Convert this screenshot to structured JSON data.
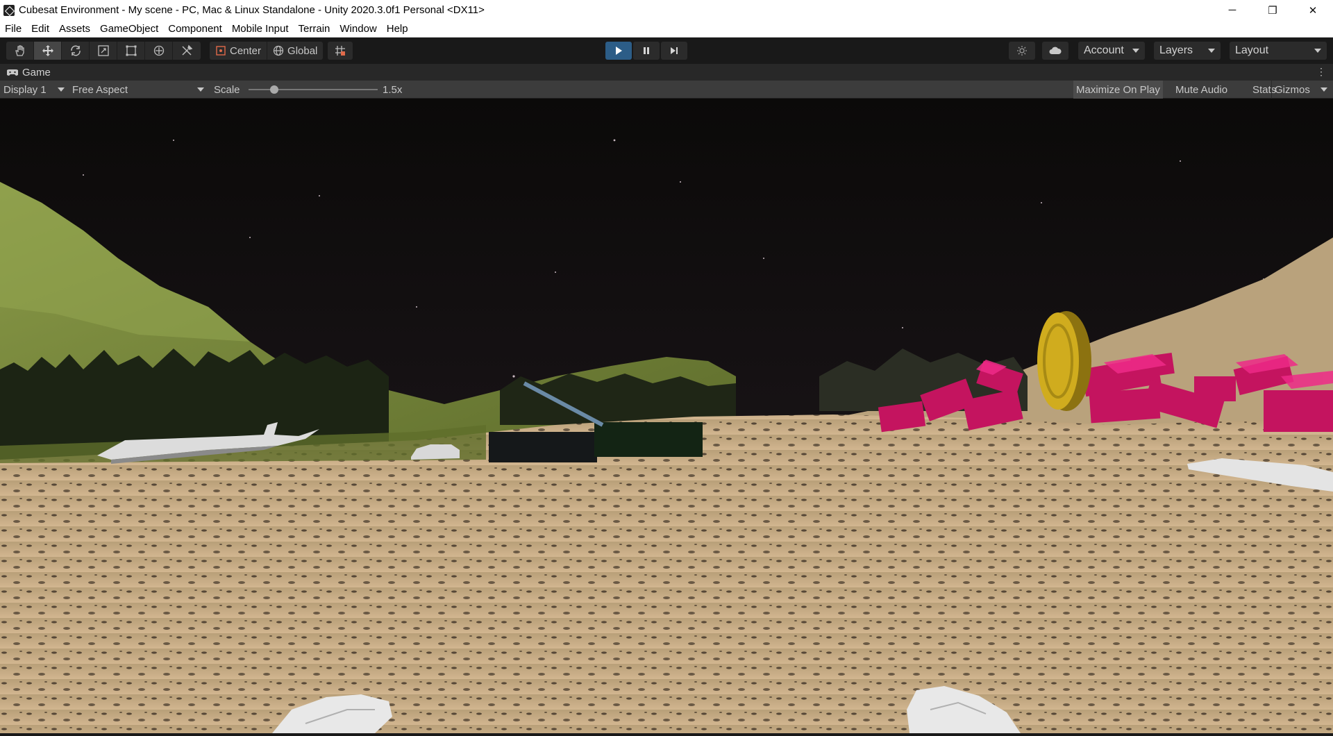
{
  "window": {
    "title": "Cubesat Environment - My scene - PC, Mac & Linux Standalone - Unity 2020.3.0f1 Personal <DX11>",
    "minimize_glyph": "─",
    "maximize_glyph": "❐",
    "close_glyph": "✕"
  },
  "menu": [
    "File",
    "Edit",
    "Assets",
    "GameObject",
    "Component",
    "Mobile Input",
    "Terrain",
    "Window",
    "Help"
  ],
  "toolbar": {
    "tools": [
      {
        "name": "hand-tool",
        "icon": "hand-icon",
        "active": false
      },
      {
        "name": "move-tool",
        "icon": "move-icon",
        "active": true
      },
      {
        "name": "rotate-tool",
        "icon": "rotate-icon",
        "active": false
      },
      {
        "name": "scale-tool",
        "icon": "scale-icon",
        "active": false
      },
      {
        "name": "rect-tool",
        "icon": "rect-icon",
        "active": false
      },
      {
        "name": "transform-tool",
        "icon": "transform-icon",
        "active": false
      },
      {
        "name": "custom-tool",
        "icon": "custom-tools-icon",
        "active": false
      }
    ],
    "pivot_label": "Center",
    "space_label": "Global",
    "account_label": "Account",
    "layers_label": "Layers",
    "layout_label": "Layout",
    "play_state": "playing",
    "accent_color": "#2c5d87"
  },
  "game_tab": {
    "label": "Game",
    "icon": "gamepad-icon"
  },
  "game_bar": {
    "display": "Display 1",
    "aspect": "Free Aspect",
    "scale_label": "Scale",
    "scale_value": "1.5x",
    "scale_fraction": 0.2,
    "maximize_on_play": "Maximize On Play",
    "maximize_on_play_enabled": true,
    "mute_audio": "Mute Audio",
    "stats": "Stats",
    "gizmos": "Gizmos"
  },
  "scene": {
    "description_icons": [
      "starfield",
      "green-hills",
      "sand-terrain",
      "airplane",
      "car",
      "dark-container",
      "gold-coin",
      "pink-crates",
      "vr-hands"
    ],
    "colors": {
      "sky": "#0a0908",
      "grass": "#7a8a3a",
      "sand": "#c9ae84",
      "crates": "#d1146b",
      "coin": "#c9a21a"
    }
  }
}
